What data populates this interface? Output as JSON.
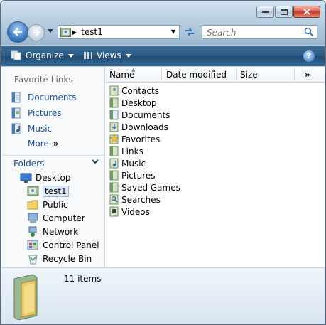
{
  "address": {
    "path": "test1"
  },
  "search": {
    "placeholder": "Search"
  },
  "toolbar": {
    "organize_label": "Organize",
    "views_label": "Views"
  },
  "favorites": {
    "title": "Favorite Links",
    "items": [
      {
        "label": "Documents",
        "icon": "documents-icon"
      },
      {
        "label": "Pictures",
        "icon": "pictures-icon"
      },
      {
        "label": "Music",
        "icon": "music-icon"
      }
    ],
    "more_label": "More",
    "more_chevron": "»"
  },
  "folders": {
    "title": "Folders",
    "tree": [
      {
        "label": "Desktop",
        "icon": "desktop-icon"
      },
      {
        "label": "test1",
        "icon": "user-folder-icon",
        "selected": true
      },
      {
        "label": "Public",
        "icon": "folder-icon"
      },
      {
        "label": "Computer",
        "icon": "computer-icon"
      },
      {
        "label": "Network",
        "icon": "network-icon"
      },
      {
        "label": "Control Panel",
        "icon": "control-panel-icon"
      },
      {
        "label": "Recycle Bin",
        "icon": "recycle-bin-icon"
      }
    ]
  },
  "columns": {
    "name": "Name",
    "date_modified": "Date modified",
    "size": "Size",
    "more": "»"
  },
  "files": [
    {
      "label": "Contacts",
      "icon": "contacts-icon"
    },
    {
      "label": "Desktop",
      "icon": "desktop-folder-icon"
    },
    {
      "label": "Documents",
      "icon": "documents-folder-icon"
    },
    {
      "label": "Downloads",
      "icon": "downloads-folder-icon"
    },
    {
      "label": "Favorites",
      "icon": "favorites-folder-icon"
    },
    {
      "label": "Links",
      "icon": "links-folder-icon"
    },
    {
      "label": "Music",
      "icon": "music-folder-icon"
    },
    {
      "label": "Pictures",
      "icon": "pictures-folder-icon"
    },
    {
      "label": "Saved Games",
      "icon": "saved-games-folder-icon"
    },
    {
      "label": "Searches",
      "icon": "searches-folder-icon"
    },
    {
      "label": "Videos",
      "icon": "videos-folder-icon"
    }
  ],
  "details": {
    "item_count": "11 items"
  },
  "colors": {
    "link": "#1a4fa0",
    "command_bar": "#2c5a83",
    "selection": "#dde9f6"
  }
}
